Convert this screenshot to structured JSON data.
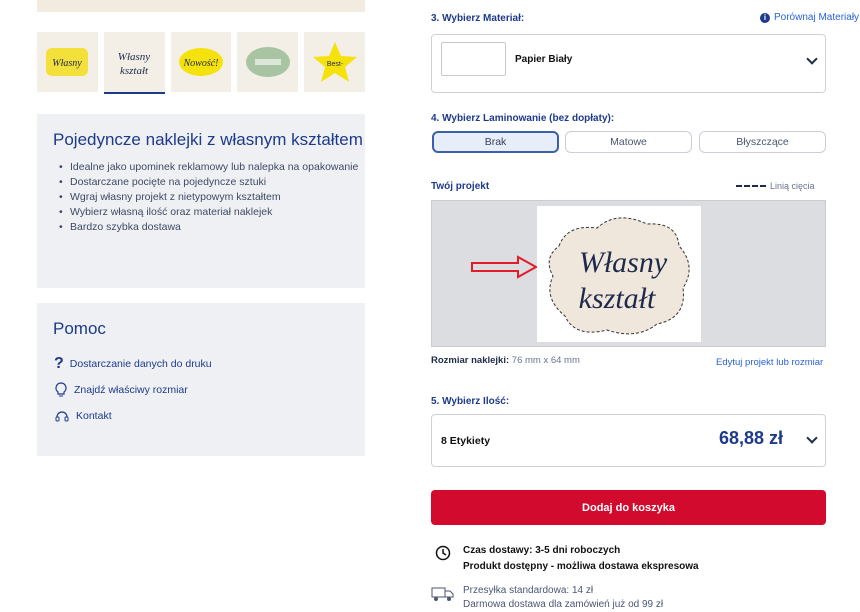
{
  "thumbs": [
    "Własny kształt - żółta naklejka",
    "Własny kształt - szkic",
    "Nowość!",
    "Zielona naklejka",
    "Best-seller"
  ],
  "product": {
    "title": "Pojedyncze naklejki z własnym kształtem",
    "features": [
      "Idealne jako upominek reklamowy lub nalepka na opakowanie",
      "Dostarczane pocięte na pojedyncze sztuki",
      "Wgraj własny projekt z nietypowym kształtem",
      "Wybierz własną ilość oraz materiał naklejek",
      "Bardzo szybka dostawa"
    ]
  },
  "help": {
    "title": "Pomoc",
    "links": [
      "Dostarczanie danych do druku",
      "Znajdź właściwy rozmiar",
      "Kontakt"
    ]
  },
  "material": {
    "label": "3. Wybierz Materiał:",
    "compare": "Porównaj Materiały",
    "selected": "Papier Biały"
  },
  "lamination": {
    "label": "4. Wybierz Laminowanie (bez dopłaty):",
    "options": [
      "Brak",
      "Matowe",
      "Błyszczące"
    ],
    "selected": "Brak"
  },
  "project": {
    "label": "Twój projekt",
    "cut_legend": "Linią cięcia",
    "size_label": "Rozmiar naklejki:",
    "size_value": "76 mm x 64 mm",
    "edit": "Edytuj projekt lub rozmiar",
    "art_line1": "Własny",
    "art_line2": "kształt"
  },
  "quantity": {
    "label": "5. Wybierz Ilość:",
    "selected": "8 Etykiety",
    "price": "68,88 zł"
  },
  "cart_button": "Dodaj do koszyka",
  "delivery": {
    "line1": "Czas dostawy: 3-5 dni roboczych",
    "line2": "Produkt dostępny - możliwa dostawa ekspresowa"
  },
  "shipping": {
    "line1": "Przesyłka standardowa: 14 zł",
    "line2": "Darmowa dostawa dla zamówień już od 99 zł"
  },
  "colors": {
    "accent": "#1e3a8a",
    "cart": "#d20a2e",
    "arrow": "#e11d2a"
  }
}
